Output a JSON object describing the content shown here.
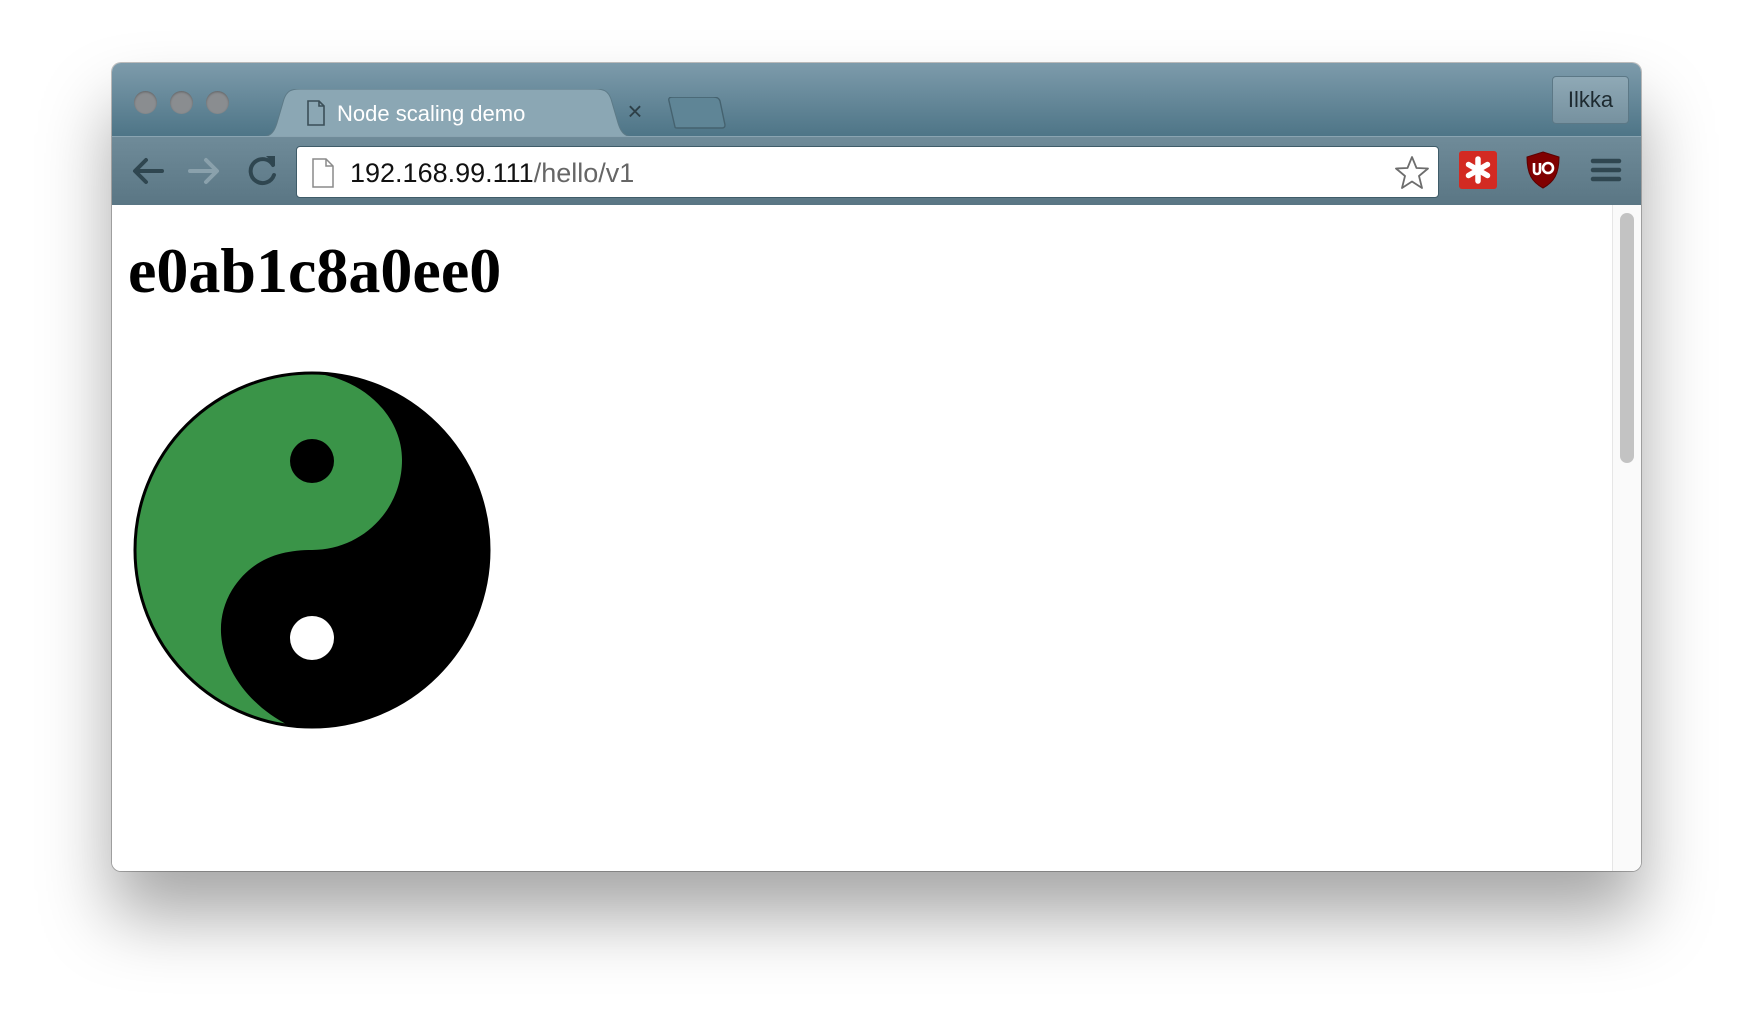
{
  "browser": {
    "tab": {
      "title": "Node scaling demo",
      "close_glyph": "×"
    },
    "profile": {
      "name": "Ilkka"
    },
    "address_bar": {
      "host": "192.168.99.111",
      "path": "/hello/v1"
    },
    "icons": {
      "back": "back-arrow-icon",
      "forward": "forward-arrow-icon",
      "reload": "reload-icon",
      "page": "page-icon",
      "bookmark": "star-icon",
      "extension_1": "lastpass-icon",
      "extension_2": "ublock-origin-icon",
      "menu": "hamburger-menu-icon"
    },
    "colors": {
      "chrome_frame": "#5a7684",
      "extension_1_bg": "#d32a22",
      "extension_2_bg": "#800000"
    }
  },
  "page": {
    "heading": "e0ab1c8a0ee0",
    "image": {
      "icon": "yin-yang-icon",
      "light_color": "#3a9448",
      "dark_color": "#000000"
    }
  }
}
